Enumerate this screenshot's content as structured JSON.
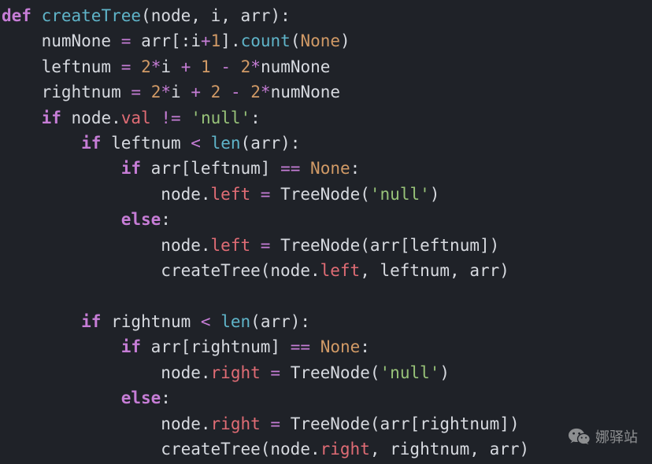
{
  "code": {
    "lines": [
      {
        "indent": 0,
        "tokens": [
          {
            "t": "def",
            "c": "kw"
          },
          {
            "t": " ",
            "c": "sp"
          },
          {
            "t": "createTree",
            "c": "fn"
          },
          {
            "t": "(",
            "c": "pun"
          },
          {
            "t": "node",
            "c": "id"
          },
          {
            "t": ", ",
            "c": "pun"
          },
          {
            "t": "i",
            "c": "id"
          },
          {
            "t": ", ",
            "c": "pun"
          },
          {
            "t": "arr",
            "c": "id"
          },
          {
            "t": ")",
            "c": "pun"
          },
          {
            "t": ":",
            "c": "pun"
          }
        ]
      },
      {
        "indent": 1,
        "tokens": [
          {
            "t": "numNone",
            "c": "id"
          },
          {
            "t": " ",
            "c": "sp"
          },
          {
            "t": "=",
            "c": "op"
          },
          {
            "t": " ",
            "c": "sp"
          },
          {
            "t": "arr",
            "c": "id"
          },
          {
            "t": "[",
            "c": "pun"
          },
          {
            "t": ":",
            "c": "pun"
          },
          {
            "t": "i",
            "c": "id"
          },
          {
            "t": "+",
            "c": "op"
          },
          {
            "t": "1",
            "c": "num"
          },
          {
            "t": "]",
            "c": "pun"
          },
          {
            "t": ".",
            "c": "pun"
          },
          {
            "t": "count",
            "c": "call"
          },
          {
            "t": "(",
            "c": "pun"
          },
          {
            "t": "None",
            "c": "none"
          },
          {
            "t": ")",
            "c": "pun"
          }
        ]
      },
      {
        "indent": 1,
        "tokens": [
          {
            "t": "leftnum",
            "c": "id"
          },
          {
            "t": " ",
            "c": "sp"
          },
          {
            "t": "=",
            "c": "op"
          },
          {
            "t": " ",
            "c": "sp"
          },
          {
            "t": "2",
            "c": "num"
          },
          {
            "t": "*",
            "c": "op"
          },
          {
            "t": "i",
            "c": "id"
          },
          {
            "t": " ",
            "c": "sp"
          },
          {
            "t": "+",
            "c": "op"
          },
          {
            "t": " ",
            "c": "sp"
          },
          {
            "t": "1",
            "c": "num"
          },
          {
            "t": " ",
            "c": "sp"
          },
          {
            "t": "-",
            "c": "op"
          },
          {
            "t": " ",
            "c": "sp"
          },
          {
            "t": "2",
            "c": "num"
          },
          {
            "t": "*",
            "c": "op"
          },
          {
            "t": "numNone",
            "c": "id"
          }
        ]
      },
      {
        "indent": 1,
        "tokens": [
          {
            "t": "rightnum",
            "c": "id"
          },
          {
            "t": " ",
            "c": "sp"
          },
          {
            "t": "=",
            "c": "op"
          },
          {
            "t": " ",
            "c": "sp"
          },
          {
            "t": "2",
            "c": "num"
          },
          {
            "t": "*",
            "c": "op"
          },
          {
            "t": "i",
            "c": "id"
          },
          {
            "t": " ",
            "c": "sp"
          },
          {
            "t": "+",
            "c": "op"
          },
          {
            "t": " ",
            "c": "sp"
          },
          {
            "t": "2",
            "c": "num"
          },
          {
            "t": " ",
            "c": "sp"
          },
          {
            "t": "-",
            "c": "op"
          },
          {
            "t": " ",
            "c": "sp"
          },
          {
            "t": "2",
            "c": "num"
          },
          {
            "t": "*",
            "c": "op"
          },
          {
            "t": "numNone",
            "c": "id"
          }
        ]
      },
      {
        "indent": 1,
        "tokens": [
          {
            "t": "if",
            "c": "kw"
          },
          {
            "t": " ",
            "c": "sp"
          },
          {
            "t": "node",
            "c": "id"
          },
          {
            "t": ".",
            "c": "pun"
          },
          {
            "t": "val",
            "c": "attr"
          },
          {
            "t": " ",
            "c": "sp"
          },
          {
            "t": "!=",
            "c": "op"
          },
          {
            "t": " ",
            "c": "sp"
          },
          {
            "t": "'null'",
            "c": "str"
          },
          {
            "t": ":",
            "c": "pun"
          }
        ]
      },
      {
        "indent": 2,
        "tokens": [
          {
            "t": "if",
            "c": "kw"
          },
          {
            "t": " ",
            "c": "sp"
          },
          {
            "t": "leftnum",
            "c": "id"
          },
          {
            "t": " ",
            "c": "sp"
          },
          {
            "t": "<",
            "c": "op"
          },
          {
            "t": " ",
            "c": "sp"
          },
          {
            "t": "len",
            "c": "call"
          },
          {
            "t": "(",
            "c": "pun"
          },
          {
            "t": "arr",
            "c": "id"
          },
          {
            "t": ")",
            "c": "pun"
          },
          {
            "t": ":",
            "c": "pun"
          }
        ]
      },
      {
        "indent": 3,
        "tokens": [
          {
            "t": "if",
            "c": "kw"
          },
          {
            "t": " ",
            "c": "sp"
          },
          {
            "t": "arr",
            "c": "id"
          },
          {
            "t": "[",
            "c": "pun"
          },
          {
            "t": "leftnum",
            "c": "id"
          },
          {
            "t": "]",
            "c": "pun"
          },
          {
            "t": " ",
            "c": "sp"
          },
          {
            "t": "==",
            "c": "op"
          },
          {
            "t": " ",
            "c": "sp"
          },
          {
            "t": "None",
            "c": "none"
          },
          {
            "t": ":",
            "c": "pun"
          }
        ]
      },
      {
        "indent": 4,
        "tokens": [
          {
            "t": "node",
            "c": "id"
          },
          {
            "t": ".",
            "c": "pun"
          },
          {
            "t": "left",
            "c": "attr"
          },
          {
            "t": " ",
            "c": "sp"
          },
          {
            "t": "=",
            "c": "op"
          },
          {
            "t": " ",
            "c": "sp"
          },
          {
            "t": "TreeNode",
            "c": "id"
          },
          {
            "t": "(",
            "c": "pun"
          },
          {
            "t": "'null'",
            "c": "str"
          },
          {
            "t": ")",
            "c": "pun"
          }
        ]
      },
      {
        "indent": 3,
        "tokens": [
          {
            "t": "else",
            "c": "kw"
          },
          {
            "t": ":",
            "c": "pun"
          }
        ]
      },
      {
        "indent": 4,
        "tokens": [
          {
            "t": "node",
            "c": "id"
          },
          {
            "t": ".",
            "c": "pun"
          },
          {
            "t": "left",
            "c": "attr"
          },
          {
            "t": " ",
            "c": "sp"
          },
          {
            "t": "=",
            "c": "op"
          },
          {
            "t": " ",
            "c": "sp"
          },
          {
            "t": "TreeNode",
            "c": "id"
          },
          {
            "t": "(",
            "c": "pun"
          },
          {
            "t": "arr",
            "c": "id"
          },
          {
            "t": "[",
            "c": "pun"
          },
          {
            "t": "leftnum",
            "c": "id"
          },
          {
            "t": "]",
            "c": "pun"
          },
          {
            "t": ")",
            "c": "pun"
          }
        ]
      },
      {
        "indent": 4,
        "tokens": [
          {
            "t": "createTree",
            "c": "id"
          },
          {
            "t": "(",
            "c": "pun"
          },
          {
            "t": "node",
            "c": "id"
          },
          {
            "t": ".",
            "c": "pun"
          },
          {
            "t": "left",
            "c": "attr"
          },
          {
            "t": ", ",
            "c": "pun"
          },
          {
            "t": "leftnum",
            "c": "id"
          },
          {
            "t": ", ",
            "c": "pun"
          },
          {
            "t": "arr",
            "c": "id"
          },
          {
            "t": ")",
            "c": "pun"
          }
        ]
      },
      {
        "indent": 0,
        "tokens": []
      },
      {
        "indent": 2,
        "tokens": [
          {
            "t": "if",
            "c": "kw"
          },
          {
            "t": " ",
            "c": "sp"
          },
          {
            "t": "rightnum",
            "c": "id"
          },
          {
            "t": " ",
            "c": "sp"
          },
          {
            "t": "<",
            "c": "op"
          },
          {
            "t": " ",
            "c": "sp"
          },
          {
            "t": "len",
            "c": "call"
          },
          {
            "t": "(",
            "c": "pun"
          },
          {
            "t": "arr",
            "c": "id"
          },
          {
            "t": ")",
            "c": "pun"
          },
          {
            "t": ":",
            "c": "pun"
          }
        ]
      },
      {
        "indent": 3,
        "tokens": [
          {
            "t": "if",
            "c": "kw"
          },
          {
            "t": " ",
            "c": "sp"
          },
          {
            "t": "arr",
            "c": "id"
          },
          {
            "t": "[",
            "c": "pun"
          },
          {
            "t": "rightnum",
            "c": "id"
          },
          {
            "t": "]",
            "c": "pun"
          },
          {
            "t": " ",
            "c": "sp"
          },
          {
            "t": "==",
            "c": "op"
          },
          {
            "t": " ",
            "c": "sp"
          },
          {
            "t": "None",
            "c": "none"
          },
          {
            "t": ":",
            "c": "pun"
          }
        ]
      },
      {
        "indent": 4,
        "tokens": [
          {
            "t": "node",
            "c": "id"
          },
          {
            "t": ".",
            "c": "pun"
          },
          {
            "t": "right",
            "c": "attr"
          },
          {
            "t": " ",
            "c": "sp"
          },
          {
            "t": "=",
            "c": "op"
          },
          {
            "t": " ",
            "c": "sp"
          },
          {
            "t": "TreeNode",
            "c": "id"
          },
          {
            "t": "(",
            "c": "pun"
          },
          {
            "t": "'null'",
            "c": "str"
          },
          {
            "t": ")",
            "c": "pun"
          }
        ]
      },
      {
        "indent": 3,
        "tokens": [
          {
            "t": "else",
            "c": "kw"
          },
          {
            "t": ":",
            "c": "pun"
          }
        ]
      },
      {
        "indent": 4,
        "tokens": [
          {
            "t": "node",
            "c": "id"
          },
          {
            "t": ".",
            "c": "pun"
          },
          {
            "t": "right",
            "c": "attr"
          },
          {
            "t": " ",
            "c": "sp"
          },
          {
            "t": "=",
            "c": "op"
          },
          {
            "t": " ",
            "c": "sp"
          },
          {
            "t": "TreeNode",
            "c": "id"
          },
          {
            "t": "(",
            "c": "pun"
          },
          {
            "t": "arr",
            "c": "id"
          },
          {
            "t": "[",
            "c": "pun"
          },
          {
            "t": "rightnum",
            "c": "id"
          },
          {
            "t": "]",
            "c": "pun"
          },
          {
            "t": ")",
            "c": "pun"
          }
        ]
      },
      {
        "indent": 4,
        "tokens": [
          {
            "t": "createTree",
            "c": "id"
          },
          {
            "t": "(",
            "c": "pun"
          },
          {
            "t": "node",
            "c": "id"
          },
          {
            "t": ".",
            "c": "pun"
          },
          {
            "t": "right",
            "c": "attr"
          },
          {
            "t": ", ",
            "c": "pun"
          },
          {
            "t": "rightnum",
            "c": "id"
          },
          {
            "t": ", ",
            "c": "pun"
          },
          {
            "t": "arr",
            "c": "id"
          },
          {
            "t": ")",
            "c": "pun"
          }
        ]
      }
    ],
    "indent_unit": "    "
  },
  "watermark": {
    "icon": "wechat-icon",
    "text": "娜驿站"
  }
}
